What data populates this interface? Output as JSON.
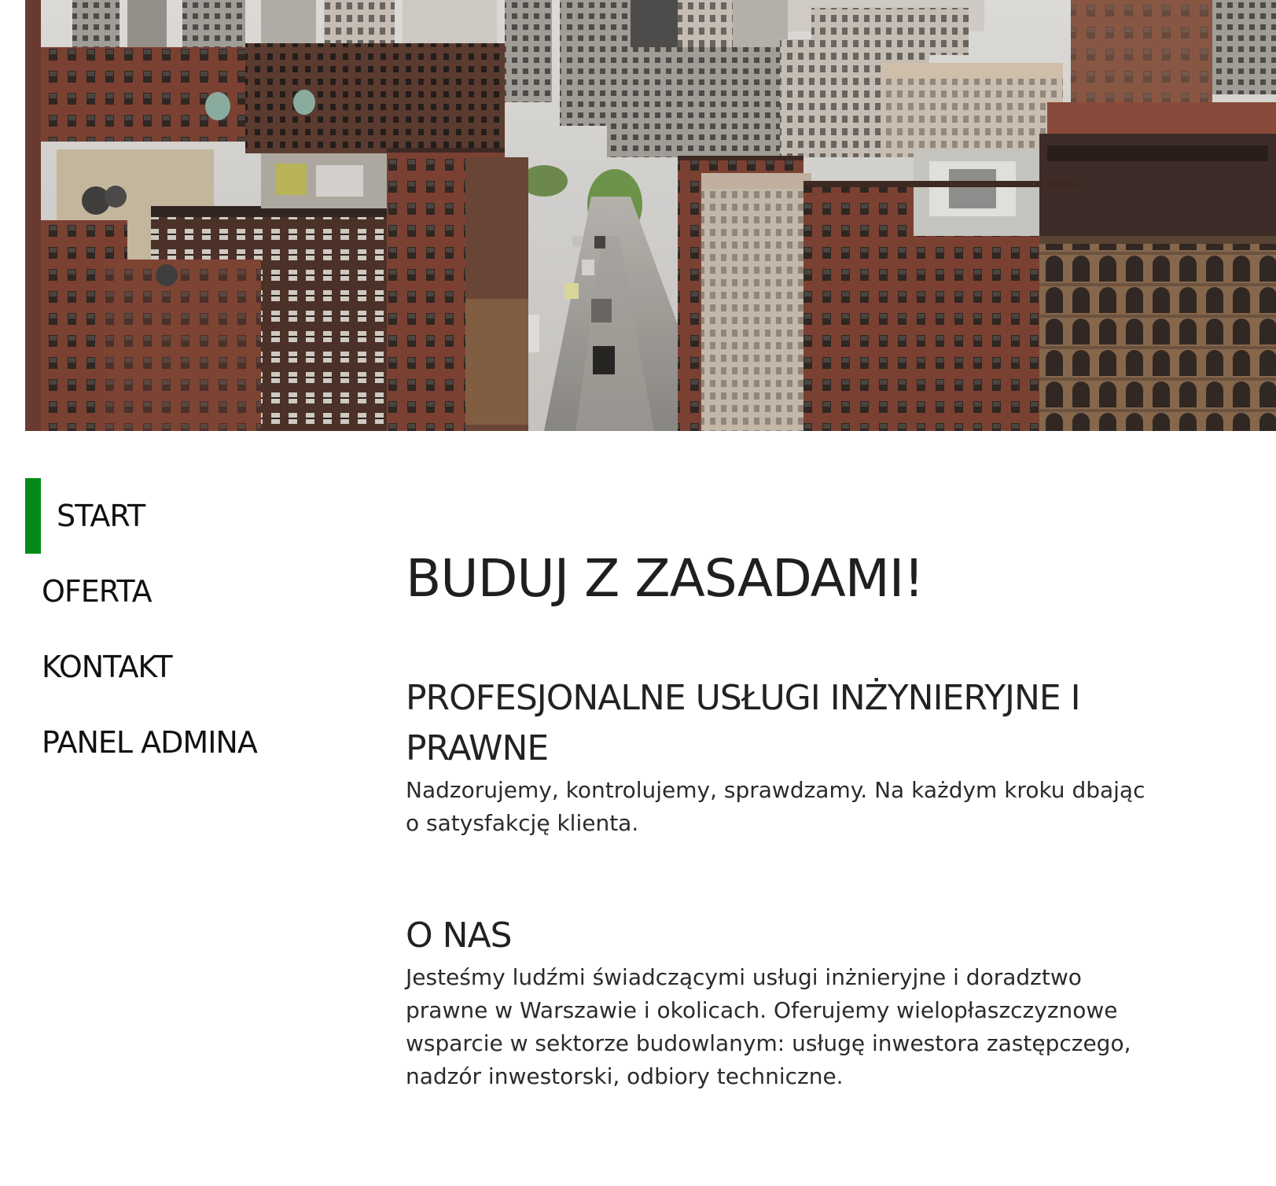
{
  "hero": {
    "image": "city-street-photo"
  },
  "nav": {
    "items": [
      {
        "label": "START",
        "active": true
      },
      {
        "label": "OFERTA",
        "active": false
      },
      {
        "label": "KONTAKT",
        "active": false
      },
      {
        "label": "PANEL ADMINA",
        "active": false
      }
    ],
    "active_color": "#008a17"
  },
  "main": {
    "title": "BUDUJ Z ZASADAMI!",
    "sections": [
      {
        "heading": "PROFESJONALNE USŁUGI INŻYNIERYJNE I PRAWNE",
        "text": "Nadzorujemy, kontrolujemy, sprawdzamy. Na każdym kroku dbając o satysfakcję klienta."
      },
      {
        "heading": "O NAS",
        "text": "Jesteśmy ludźmi świadczącymi usługi inżnieryjne i doradztwo prawne w Warszawie i okolicach. Oferujemy wielopłaszczyznowe wsparcie w sektorze budowlanym: usługę inwestora zastępczego, nadzór inwestorski, odbiory techniczne."
      }
    ]
  }
}
